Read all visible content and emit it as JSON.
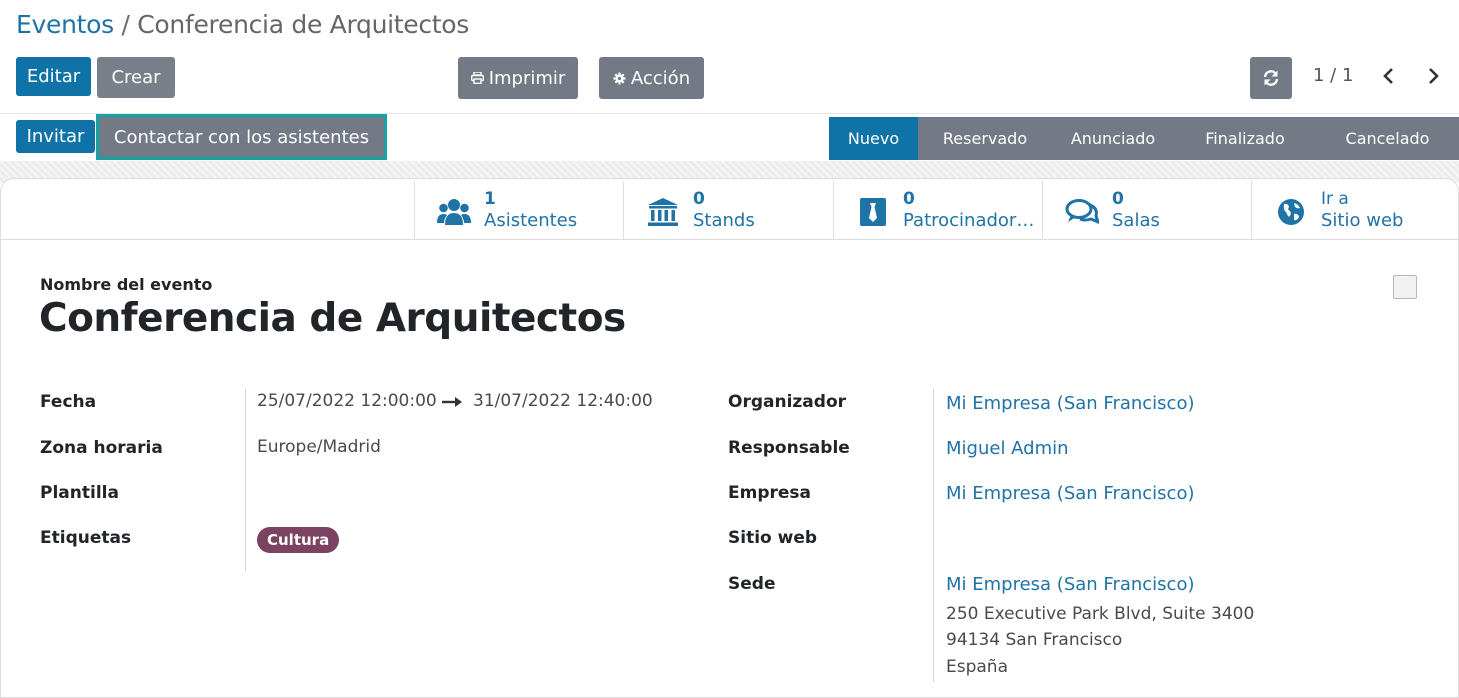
{
  "breadcrumb": {
    "parent": "Eventos",
    "separator": "/",
    "current": "Conferencia de Arquitectos"
  },
  "toolbar": {
    "edit": "Editar",
    "create": "Crear",
    "print": "Imprimir",
    "action": "Acción",
    "pager": "1 / 1"
  },
  "header_buttons": {
    "invite": "Invitar",
    "contact": "Contactar con los asistentes"
  },
  "stages": [
    {
      "label": "Nuevo",
      "active": true
    },
    {
      "label": "Reservado",
      "active": false
    },
    {
      "label": "Anunciado",
      "active": false
    },
    {
      "label": "Finalizado",
      "active": false
    },
    {
      "label": "Cancelado",
      "active": false
    }
  ],
  "smart_buttons": [
    {
      "value": "1",
      "label": "Asistentes",
      "icon": "users-icon"
    },
    {
      "value": "0",
      "label": "Stands",
      "icon": "bank-icon"
    },
    {
      "value": "0",
      "label": "Patrocinador…",
      "icon": "sponsor-icon"
    },
    {
      "value": "0",
      "label": "Salas",
      "icon": "comments-icon"
    },
    {
      "value": "Ir a",
      "label": "Sitio web",
      "icon": "globe-icon"
    }
  ],
  "form": {
    "name_label": "Nombre del evento",
    "name": "Conferencia de Arquitectos",
    "left": {
      "date_label": "Fecha",
      "date_start": "25/07/2022 12:00:00",
      "date_end": "31/07/2022 12:40:00",
      "tz_label": "Zona horaria",
      "tz": "Europe/Madrid",
      "template_label": "Plantilla",
      "tags_label": "Etiquetas",
      "tag": "Cultura"
    },
    "right": {
      "organizer_label": "Organizador",
      "organizer": "Mi Empresa (San Francisco)",
      "responsible_label": "Responsable",
      "responsible": "Miguel Admin",
      "company_label": "Empresa",
      "company": "Mi Empresa (San Francisco)",
      "website_label": "Sitio web",
      "venue_label": "Sede",
      "venue": "Mi Empresa (San Francisco)",
      "address_line1": "250 Executive Park Blvd, Suite 3400",
      "address_line2": "94134 San Francisco",
      "address_line3": "España"
    }
  },
  "colors": {
    "primary": "#0f73a8",
    "link": "#1f73a6",
    "stage_inactive": "#737985",
    "tag": "#7c4262",
    "highlight": "#14a3a0"
  }
}
